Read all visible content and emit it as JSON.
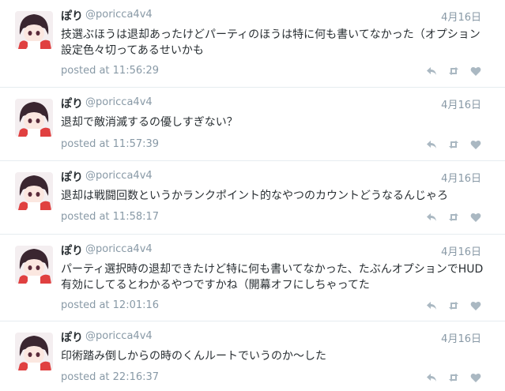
{
  "tweets": [
    {
      "name": "ぽり",
      "handle": "@poricca4v4",
      "date": "4月16日",
      "text": "技選ぶほうは退却あったけどパーティのほうは特に何も書いてなかった（オプション設定色々切ってあるせいかも",
      "time": "posted at 11:56:29"
    },
    {
      "name": "ぽり",
      "handle": "@poricca4v4",
      "date": "4月16日",
      "text": "退却で敵消滅するの優しすぎない？",
      "time": "posted at 11:57:39"
    },
    {
      "name": "ぽり",
      "handle": "@poricca4v4",
      "date": "4月16日",
      "text": "退却は戦闘回数というかランクポイント的なやつのカウントどうなるんじゃろ",
      "time": "posted at 11:58:17"
    },
    {
      "name": "ぽり",
      "handle": "@poricca4v4",
      "date": "4月16日",
      "text": "パーティ選択時の退却できたけど特に何も書いてなかった、たぶんオプションでHUD有効にしてるとわかるやつですかね（開幕オフにしちゃってた",
      "time": "posted at 12:01:16"
    },
    {
      "name": "ぽり",
      "handle": "@poricca4v4",
      "date": "4月16日",
      "text": "印術踏み倒しからの時のくんルートでいうのか〜した",
      "time": "posted at 22:16:37"
    }
  ],
  "icons": {
    "reply": "reply-icon",
    "retweet": "retweet-icon",
    "like": "heart-icon",
    "avatar": "anime-avatar"
  },
  "colors": {
    "muted": "#8899a6",
    "text": "#292f33",
    "divider": "#e6ecf0",
    "icon": "#aab8c2"
  }
}
